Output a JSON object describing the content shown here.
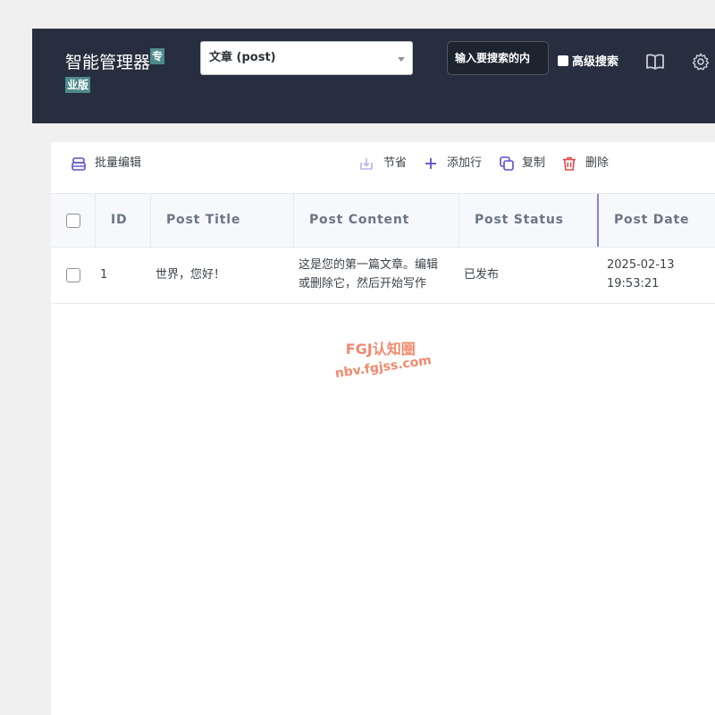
{
  "header": {
    "brand_title": "智能管理器",
    "brand_badge_line1": "专",
    "brand_badge_line2": "业版",
    "post_type_select": "文章 (post)",
    "search_placeholder": "输入要搜索的内",
    "advanced_search_label": "高级搜索",
    "icons": [
      "book-icon",
      "gear-icon"
    ]
  },
  "toolbar": {
    "bulk_edit": "批量编辑",
    "save": "节省",
    "add_row": "添加行",
    "copy": "复制",
    "delete": "删除"
  },
  "table": {
    "columns": [
      "ID",
      "Post Title",
      "Post Content",
      "Post Status",
      "Post Date"
    ],
    "rows": [
      {
        "id": "1",
        "title": "世界，您好！",
        "content_line1": "这是您的第一篇文章。编辑",
        "content_line2": "或删除它，然后开始写作",
        "status": "已发布",
        "date_line1": "2025-02-13",
        "date_line2": "19:53:21"
      }
    ]
  },
  "watermark": {
    "line1": "FGJ认知圈",
    "line2": "nbv.fgjss.com"
  },
  "colors": {
    "header_bg": "#262e3f",
    "accent": "#5b4fcf",
    "delete": "#e0474c",
    "watermark": "#f08a6e"
  }
}
